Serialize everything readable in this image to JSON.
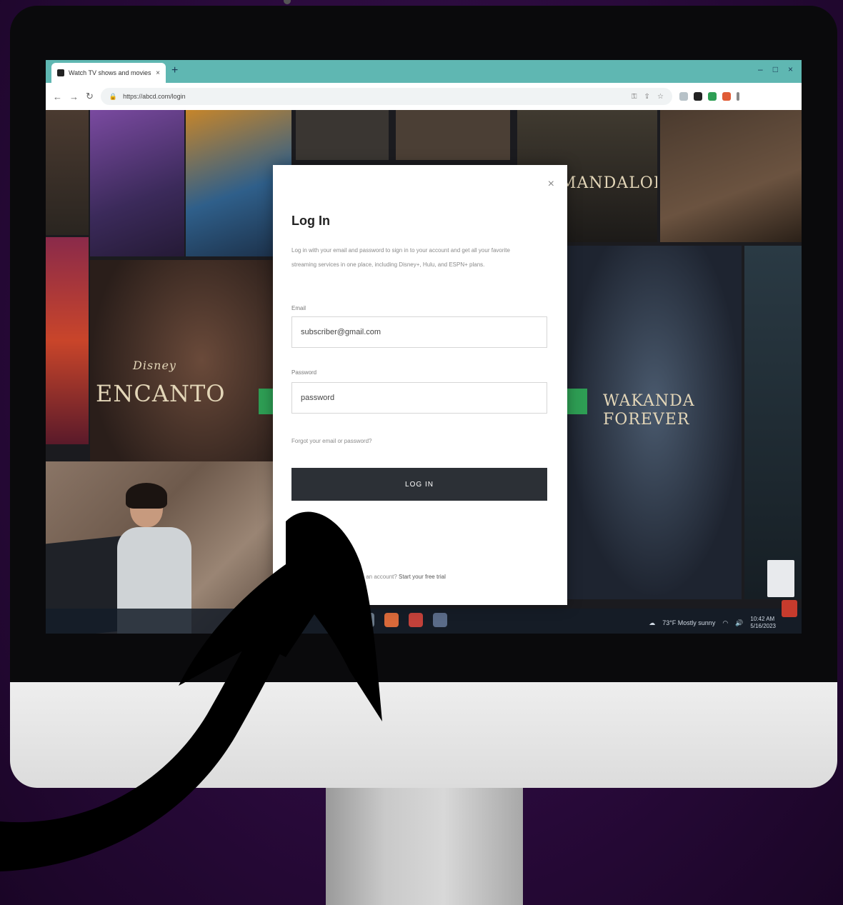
{
  "browser": {
    "tab_title": "Watch TV shows and movies",
    "tab_close": "×",
    "new_tab": "+",
    "url": "https://abcd.com/login",
    "window_controls": [
      "–",
      "□",
      "×"
    ]
  },
  "posters": {
    "mandalorian": "MANDALORIAN",
    "encanto": "ENCANTO",
    "encanto_brand": "Disney",
    "wakanda": "WAKANDA FOREVER"
  },
  "modal": {
    "close": "×",
    "title": "Log In",
    "description": "Log in with your email and password to sign in to your account and get all your favorite streaming services in one place, including Disney+, Hulu, and ESPN+ plans.",
    "email_label": "Email",
    "email_value": "subscriber@gmail.com",
    "password_label": "Password",
    "password_value": "password",
    "forgot": "Forgot your email or password?",
    "login_button": "LOG IN",
    "signup_prompt": "Don't have an account?",
    "signup_link": "Start your free trial"
  },
  "taskbar": {
    "weather": "73°F Mostly sunny",
    "time": "10:42 AM",
    "date": "5/16/2023"
  },
  "colors": {
    "tab_strip": "#5fb7b2",
    "login_button": "#2c3036",
    "background": "#2a0a3c",
    "cta_green": "#2e9e54"
  }
}
